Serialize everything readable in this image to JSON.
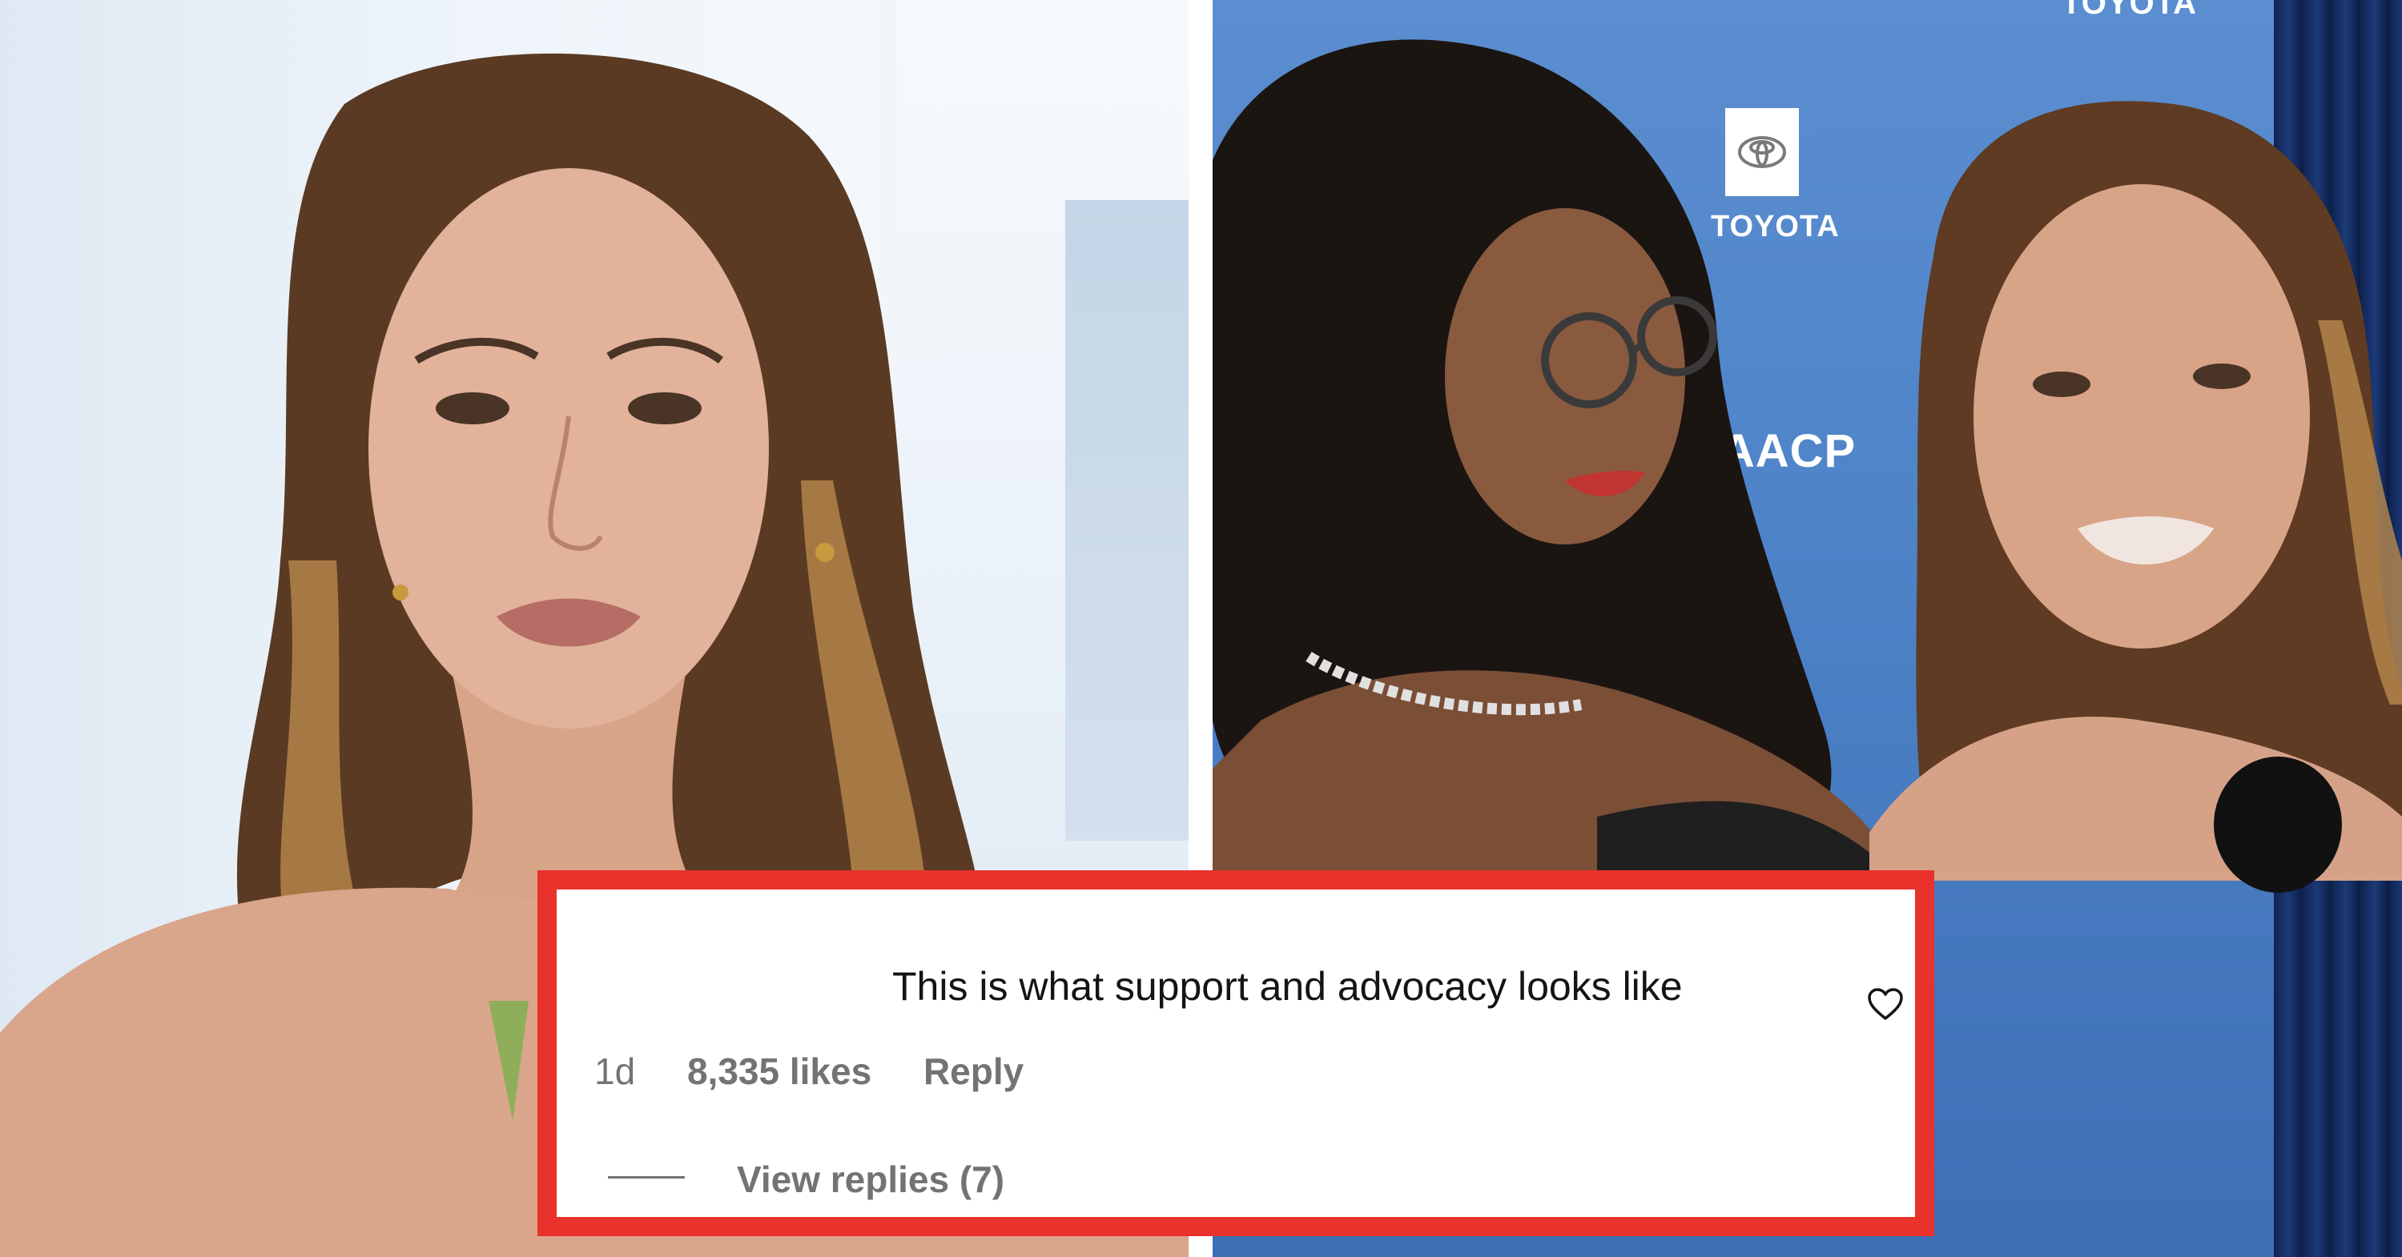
{
  "backdrop": {
    "sponsor_logo_text": "TOYOTA",
    "sponsor_logo_top_text": "TOYOTA",
    "event_logo_text": "NAACP"
  },
  "comment": {
    "text": "This is what support and advocacy looks like",
    "time": "1d",
    "likes": "8,335 likes",
    "reply_label": "Reply",
    "view_replies_label": "View replies (7)"
  },
  "colors": {
    "card_border": "#e8322b",
    "meta_text": "#737373",
    "comment_text": "#141414"
  },
  "icons": {
    "like": "heart-icon"
  }
}
